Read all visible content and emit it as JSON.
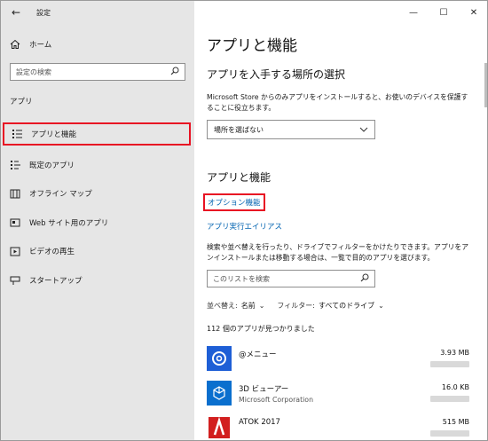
{
  "sidebar": {
    "back_glyph": "←",
    "app_title": "設定",
    "home_label": "ホーム",
    "search_placeholder": "設定の検索",
    "section_label": "アプリ",
    "items": [
      {
        "label": "アプリと機能",
        "icon": "apps-features-icon",
        "active": true
      },
      {
        "label": "既定のアプリ",
        "icon": "default-apps-icon",
        "active": false
      },
      {
        "label": "オフライン マップ",
        "icon": "offline-maps-icon",
        "active": false
      },
      {
        "label": "Web サイト用のアプリ",
        "icon": "apps-for-websites-icon",
        "active": false
      },
      {
        "label": "ビデオの再生",
        "icon": "video-playback-icon",
        "active": false
      },
      {
        "label": "スタートアップ",
        "icon": "startup-icon",
        "active": false
      }
    ]
  },
  "window_controls": {
    "minimize": "—",
    "maximize": "☐",
    "close": "✕"
  },
  "main": {
    "title": "アプリと機能",
    "install_heading": "アプリを入手する場所の選択",
    "install_desc": "Microsoft Store からのみアプリをインストールすると、お使いのデバイスを保護することに役立ちます。",
    "install_dropdown_value": "場所を選ばない",
    "features_heading": "アプリと機能",
    "optional_features_link": "オプション機能",
    "alias_link": "アプリ実行エイリアス",
    "features_desc": "検索や並べ替えを行ったり、ドライブでフィルターをかけたりできます。アプリをアンインストールまたは移動する場合は、一覧で目的のアプリを選びます。",
    "list_search_placeholder": "このリストを検索",
    "sort_label": "並べ替え:",
    "sort_value": "名前",
    "filter_label": "フィルター:",
    "filter_value": "すべてのドライブ",
    "count_text": "112 個のアプリが見つかりました",
    "apps": [
      {
        "name": "@メニュー",
        "publisher": "",
        "size": "3.93 MB",
        "icon": "at-menu-icon",
        "color": "#1e5fd6"
      },
      {
        "name": "3D ビューアー",
        "publisher": "Microsoft Corporation",
        "size": "16.0 KB",
        "icon": "3d-viewer-icon",
        "color": "#0a6fce"
      },
      {
        "name": "ATOK 2017",
        "publisher": "",
        "size": "515 MB",
        "icon": "atok-icon",
        "color": "#d21f1f"
      }
    ]
  },
  "colors": {
    "sidebar_bg": "#e6e6e6",
    "highlight": "#e81123",
    "link": "#0063b1"
  }
}
